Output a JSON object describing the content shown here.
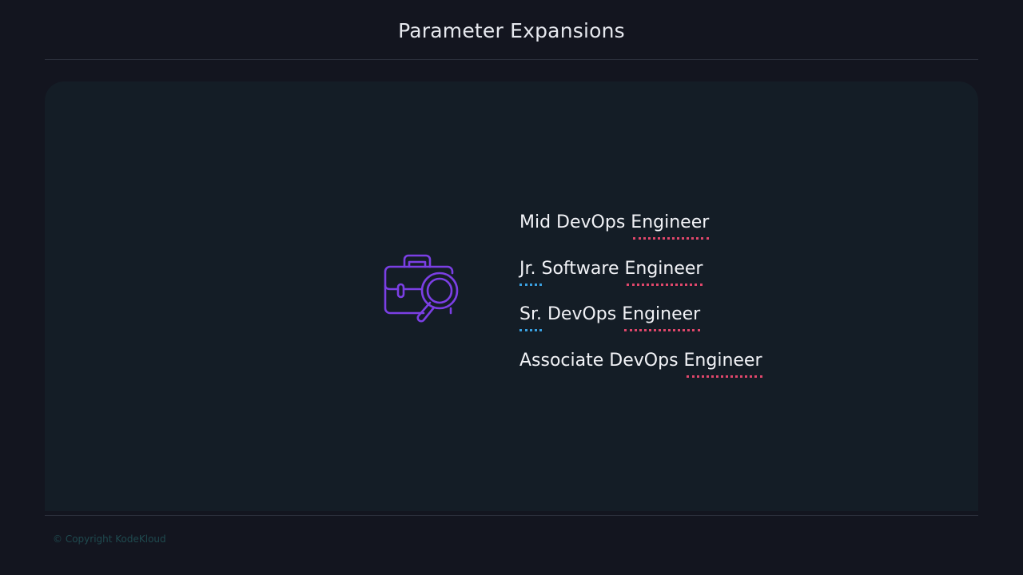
{
  "slide": {
    "title": "Parameter Expansions",
    "footer": "© Copyright KodeKloud"
  },
  "icon": "briefcase-search-icon",
  "colors": {
    "icon": "#7b3fe4",
    "highlight_engineer": "#e0476b",
    "highlight_prefix": "#3aa0e0"
  },
  "lines": [
    {
      "prefix": "Mid",
      "middle": " DevOps ",
      "suffix": "Engineer",
      "prefix_marked": false
    },
    {
      "prefix": "Jr.",
      "middle": " Software ",
      "suffix": "Engineer",
      "prefix_marked": true
    },
    {
      "prefix": "Sr.",
      "middle": " DevOps ",
      "suffix": "Engineer",
      "prefix_marked": true
    },
    {
      "prefix": "Associate",
      "middle": " DevOps ",
      "suffix": "Engineer",
      "prefix_marked": false
    }
  ]
}
